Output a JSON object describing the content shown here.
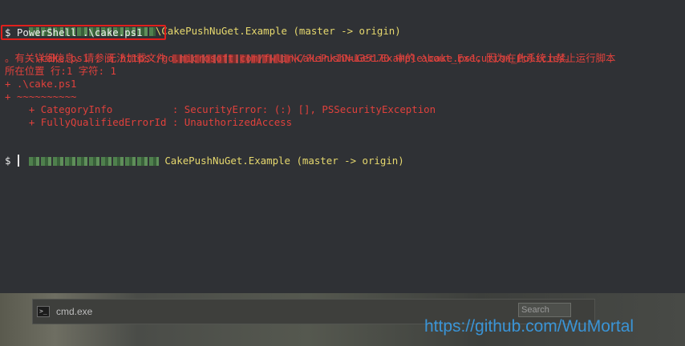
{
  "terminal": {
    "prompt_path_1": "\\CakePushNuGet.Example",
    "branch_1": "(master -> origin)",
    "command_line": "$ PowerShell .\\cake.ps1",
    "error_1_start": ".\\cake.ps1 : 无法加载文件",
    "error_1_end": "\\CakePushNuGet.Example\\cake.ps1，因为在此系统上禁止运行脚本",
    "error_2": "。有关详细信息，请参阅 https:/go.microsoft.com/fwlink/?LinkID=135170 中的 about_Execution_Policies。",
    "error_3": "所在位置 行:1 字符: 1",
    "error_4": "+ .\\cake.ps1",
    "error_5": "+ ~~~~~~~~~~",
    "error_6": "    + CategoryInfo          : SecurityError: (:) [], PSSecurityException",
    "error_7": "    + FullyQualifiedErrorId : UnauthorizedAccess",
    "prompt_path_2": "CakePushNuGet.Example",
    "branch_2": "(master -> origin)",
    "prompt_symbol": "$"
  },
  "taskbar": {
    "cmd_label": "cmd.exe",
    "search_placeholder": "Search"
  },
  "watermark": "https://github.com/WuMortal"
}
